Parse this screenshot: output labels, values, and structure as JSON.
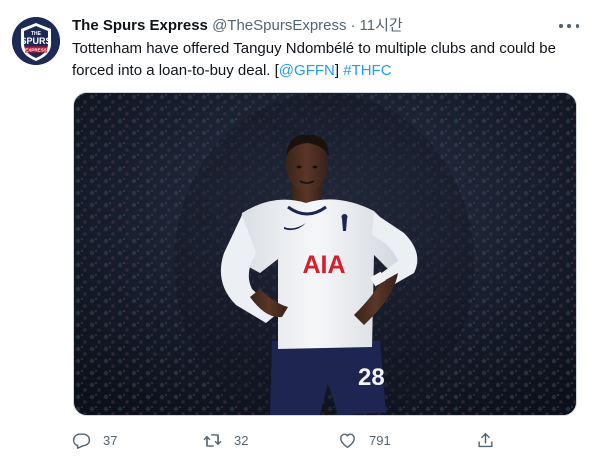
{
  "tweet": {
    "display_name": "The Spurs Express",
    "handle": "@TheSpursExpress",
    "separator": "·",
    "time": "11시간",
    "text_before": "Tottenham have offered Tanguy Ndombélé to multiple clubs and could be forced into a loan-to-buy deal. [",
    "mention": "@GFFN",
    "text_between": "] ",
    "hashtag": "#THFC"
  },
  "avatar": {
    "logo_line1": "THE",
    "logo_line2": "SPURS",
    "logo_line3": "EXPRESS"
  },
  "media": {
    "shirt_sponsor": "AIA",
    "shirt_number": "28"
  },
  "actions": {
    "reply_count": "37",
    "retweet_count": "32",
    "like_count": "791"
  },
  "colors": {
    "link": "#1d9bf0",
    "secondary_text": "#536471",
    "avatar_bg": "#1e2a56"
  },
  "icons": [
    "more-icon",
    "reply-icon",
    "retweet-icon",
    "like-icon",
    "share-icon"
  ]
}
